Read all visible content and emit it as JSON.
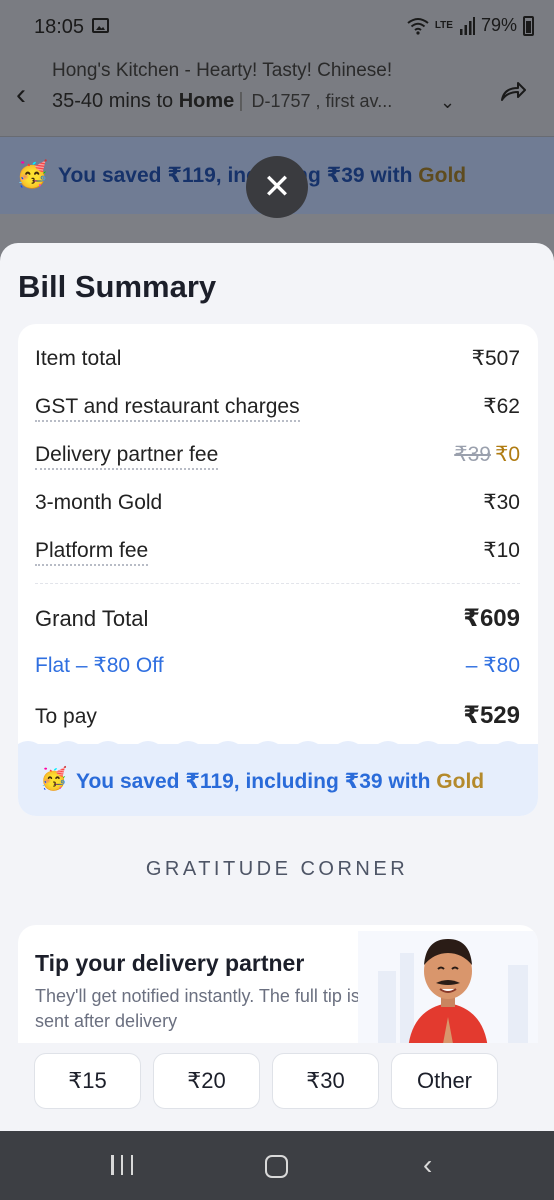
{
  "status_bar": {
    "time": "18:05",
    "network": "LTE",
    "battery": "79%"
  },
  "header": {
    "restaurant": "Hong's Kitchen - Hearty! Tasty! Chinese!",
    "eta_prefix": "35-40 mins to",
    "eta_dest": "Home",
    "address": "D-1757 , first av..."
  },
  "banner": {
    "savings_text": "You saved ₹119, including ₹39 with",
    "gold": "Gold"
  },
  "sheet": {
    "title": "Bill Summary",
    "items": [
      {
        "label": "Item total",
        "value": "₹507"
      },
      {
        "label": "GST and restaurant charges",
        "value": "₹62"
      },
      {
        "label": "Delivery partner fee",
        "old_value": "₹39",
        "value": "₹0"
      },
      {
        "label": "3-month Gold",
        "value": "₹30"
      },
      {
        "label": "Platform fee",
        "value": "₹10"
      }
    ],
    "grand_total": {
      "label": "Grand Total",
      "value": "₹609"
    },
    "discount": {
      "label": "Flat – ₹80 Off",
      "value": "– ₹80"
    },
    "to_pay": {
      "label": "To pay",
      "value": "₹529"
    },
    "savings": {
      "text": "You saved ₹119, including ₹39 with",
      "gold": "Gold"
    },
    "gratitude": "GRATITUDE CORNER",
    "tip": {
      "title": "Tip your delivery partner",
      "subtitle": "They'll get notified instantly. The full tip is sent after delivery",
      "options": [
        "₹15",
        "₹20",
        "₹30",
        "Other"
      ]
    }
  },
  "colors": {
    "accent_blue": "#2a6bd9",
    "gold": "#b48a2c"
  }
}
